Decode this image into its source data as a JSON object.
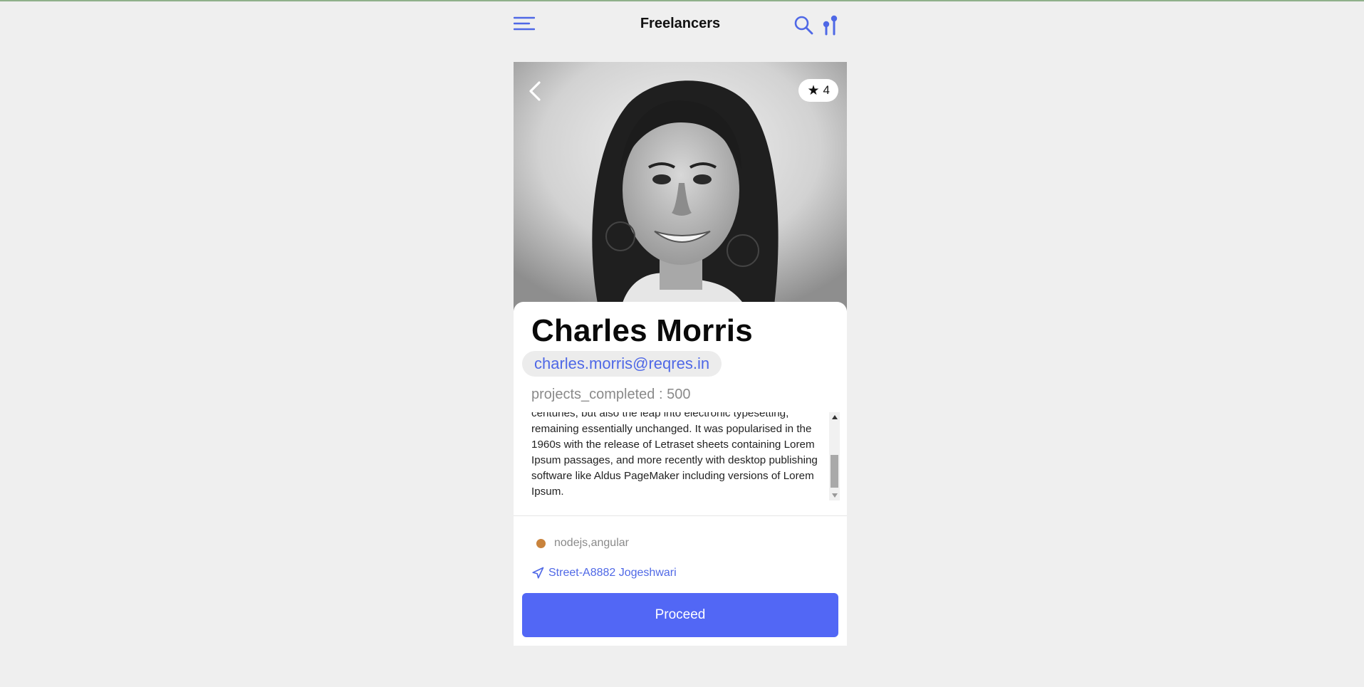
{
  "header": {
    "title": "Freelancers",
    "menu_icon": "hamburger-menu-icon",
    "search_icon": "search-icon",
    "sort_icon": "sort-icon"
  },
  "profile": {
    "back_icon": "chevron-left-icon",
    "rating": "4",
    "rating_icon": "star-icon",
    "name": "Charles Morris",
    "email": "charles.morris@reqres.in",
    "projects": "projects_completed : 500",
    "bio": "centuries, but also the leap into electronic typesetting, remaining essentially unchanged. It was popularised in the 1960s with the release of Letraset sheets containing Lorem Ipsum passages, and more recently with desktop publishing software like Aldus PageMaker including versions of Lorem Ipsum.",
    "skills": "nodejs,angular",
    "location": "Street-A8882 Jogeshwari",
    "location_icon": "navigation-arrow-icon",
    "proceed_label": "Proceed"
  },
  "colors": {
    "accent": "#5267f5",
    "link": "#4f68e6",
    "skill_dot": "#c9833c",
    "background": "#efefef"
  }
}
